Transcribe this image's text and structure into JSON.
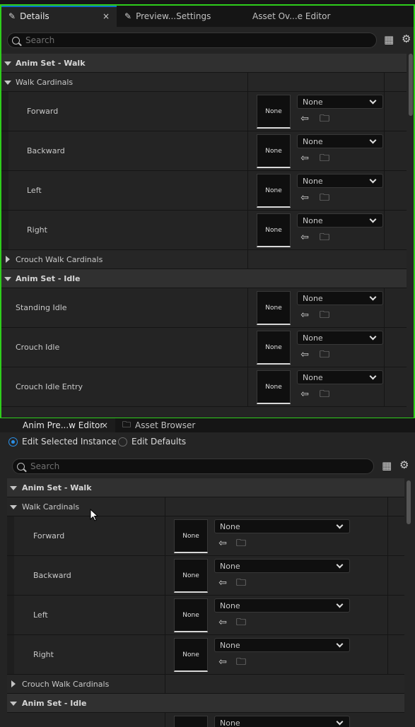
{
  "top_panel": {
    "tabs": [
      {
        "label": "Details",
        "close": "×"
      },
      {
        "label": "Preview...Settings"
      },
      {
        "label": "Asset Ov...e Editor"
      }
    ],
    "search_placeholder": "Search",
    "sections": {
      "walk": "Anim Set - Walk",
      "walk_cardinals": "Walk Cardinals",
      "walk_props": [
        {
          "label": "Forward",
          "thumb": "None",
          "combo": "None"
        },
        {
          "label": "Backward",
          "thumb": "None",
          "combo": "None"
        },
        {
          "label": "Left",
          "thumb": "None",
          "combo": "None"
        },
        {
          "label": "Right",
          "thumb": "None",
          "combo": "None"
        }
      ],
      "crouch_walk_cardinals": "Crouch Walk Cardinals",
      "idle": "Anim Set - Idle",
      "idle_props": [
        {
          "label": "Standing Idle",
          "thumb": "None",
          "combo": "None"
        },
        {
          "label": "Crouch Idle",
          "thumb": "None",
          "combo": "None"
        },
        {
          "label": "Crouch Idle Entry",
          "thumb": "None",
          "combo": "None"
        }
      ]
    }
  },
  "bottom_panel": {
    "tabs": [
      {
        "label": "Anim Pre...w Editor",
        "close": "×"
      },
      {
        "label": "Asset Browser"
      }
    ],
    "radio_options": [
      {
        "label": "Edit Selected Instance",
        "selected": true
      },
      {
        "label": "Edit Defaults",
        "selected": false
      }
    ],
    "search_placeholder": "Search",
    "sections": {
      "walk": "Anim Set - Walk",
      "walk_cardinals": "Walk Cardinals",
      "walk_props": [
        {
          "label": "Forward",
          "thumb": "None",
          "combo": "None"
        },
        {
          "label": "Backward",
          "thumb": "None",
          "combo": "None"
        },
        {
          "label": "Left",
          "thumb": "None",
          "combo": "None"
        },
        {
          "label": "Right",
          "thumb": "None",
          "combo": "None"
        }
      ],
      "crouch_walk_cardinals": "Crouch Walk Cardinals",
      "idle": "Anim Set - Idle",
      "idle_partial_combo": "None"
    }
  },
  "colors": {
    "focus_border": "#2ece1b",
    "accent_blue": "#0a6fc7",
    "panel_bg": "#242424"
  },
  "icons": [
    "pencil-icon",
    "gear-icon",
    "table-view-icon",
    "search-icon",
    "use-selected-arrow-icon",
    "browse-folder-icon",
    "chevron-down-icon",
    "folder-tab-icon",
    "cursor-icon"
  ]
}
